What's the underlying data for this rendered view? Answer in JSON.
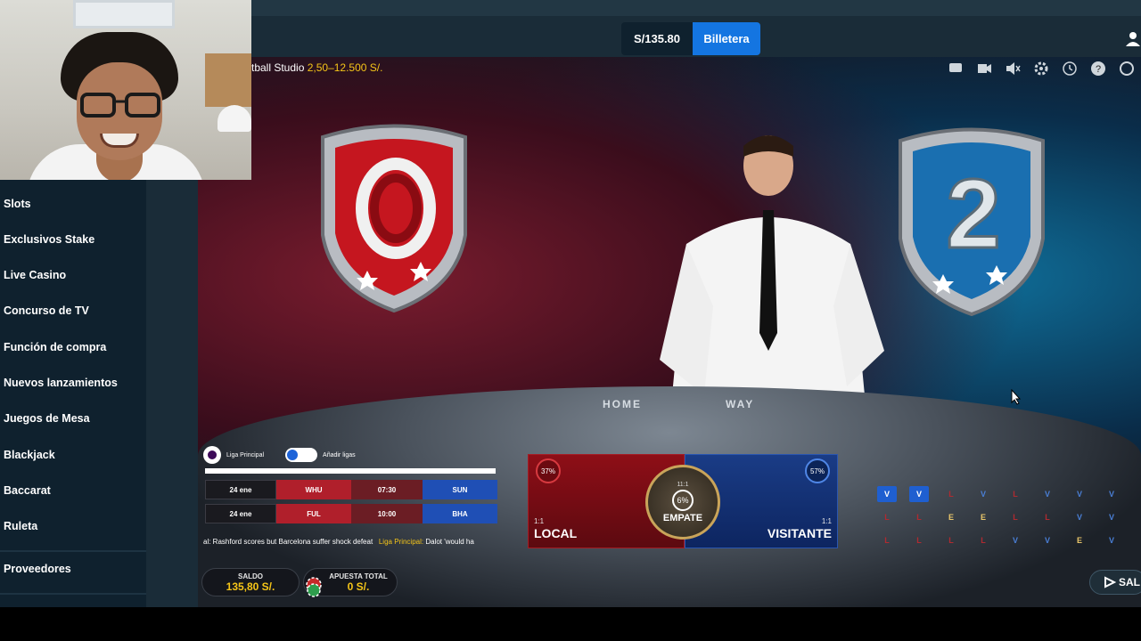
{
  "header": {
    "balance": "S/135.80",
    "wallet_button": "Billetera"
  },
  "sidebar": {
    "items": [
      {
        "label": "Slots"
      },
      {
        "label": "Exclusivos Stake"
      },
      {
        "label": "Live Casino"
      },
      {
        "label": "Concurso de TV"
      },
      {
        "label": "Función de compra"
      },
      {
        "label": "Nuevos lanzamientos"
      },
      {
        "label": "Juegos de Mesa"
      },
      {
        "label": "Blackjack"
      },
      {
        "label": "Baccarat"
      },
      {
        "label": "Ruleta"
      },
      {
        "label": "Proveedores"
      }
    ]
  },
  "game": {
    "title": "tball Studio",
    "limits": "2,50–12.500 S/.",
    "table_home": "HOME",
    "table_away": "WAY",
    "tools": [
      "chat-icon",
      "video-icon",
      "mute-icon",
      "settings-icon",
      "history-icon",
      "help-icon",
      "fullscreen-icon"
    ]
  },
  "league": {
    "name": "Liga Principal",
    "add_label": "Añadir ligas",
    "matches": [
      {
        "date": "24 ene",
        "home": "WHU",
        "time": "07:30",
        "away": "SUN"
      },
      {
        "date": "24 ene",
        "home": "FUL",
        "time": "10:00",
        "away": "BHA"
      }
    ],
    "ticker_prefix": "al: Rashford scores but Barcelona suffer shock defeat",
    "ticker_league": "Liga Principal:",
    "ticker_suffix": "Dalot 'would ha"
  },
  "bets": {
    "local": {
      "label": "LOCAL",
      "odds": "1:1",
      "pct": "37%"
    },
    "tie": {
      "label": "EMPATE",
      "odds": "11:1",
      "pct": "6%"
    },
    "visitor": {
      "label": "VISITANTE",
      "odds": "1:1",
      "pct": "57%"
    }
  },
  "road": {
    "row1": [
      "V",
      "V",
      "L",
      "V",
      "L",
      "V",
      "V",
      "V",
      "V"
    ],
    "row2": [
      "L",
      "L",
      "E",
      "E",
      "L",
      "L",
      "V",
      "V",
      "V"
    ],
    "row3": [
      "L",
      "L",
      "L",
      "L",
      "V",
      "V",
      "V",
      "E",
      "V"
    ]
  },
  "footer": {
    "balance_label": "SALDO",
    "balance_value": "135,80 S/.",
    "total_bet_label": "APUESTA TOTAL",
    "total_bet_value": "0 S/.",
    "exit_label": "SAL"
  },
  "colors": {
    "accent": "#1475e1",
    "gold": "#f5c518",
    "local": "#8e0e17",
    "visitor": "#1a3c86"
  }
}
